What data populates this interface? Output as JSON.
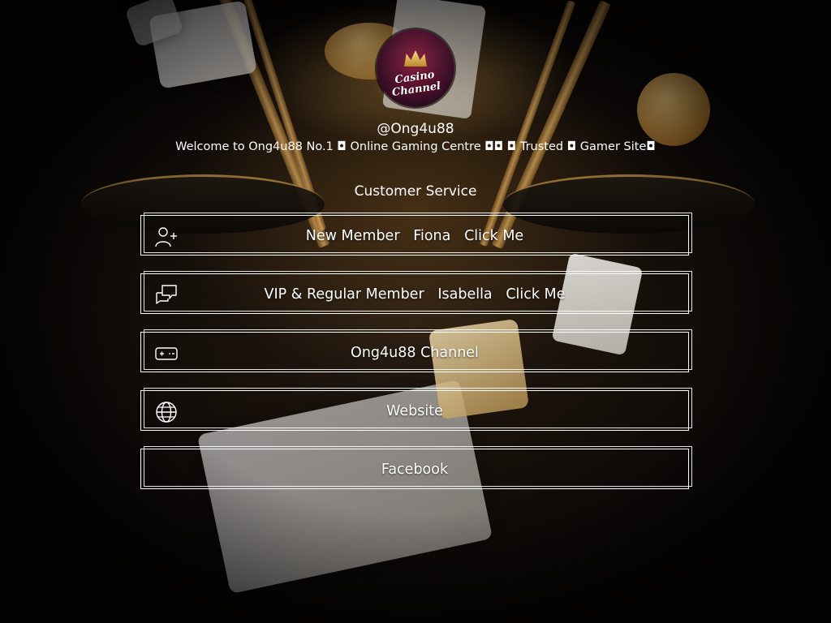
{
  "profile": {
    "avatar_text": "Casino Channel",
    "handle": "@Ong4u88",
    "welcome": "Welcome to Ong4u88 No.1 ◘ Online Gaming Centre ◘◘ ◘ Trusted ◘ Gamer Site◘"
  },
  "section": {
    "title": "Customer Service"
  },
  "links": [
    {
      "label": "New Member   Fiona   Click Me",
      "icon": "add-user-icon"
    },
    {
      "label": "VIP & Regular Member   Isabella   Click Me",
      "icon": "chat-bubbles-icon"
    },
    {
      "label": "Ong4u88 Channel",
      "icon": "gamepad-icon"
    },
    {
      "label": "Website",
      "icon": "globe-icon"
    },
    {
      "label": "Facebook",
      "icon": ""
    }
  ],
  "colors": {
    "text": "#ffffff",
    "border": "#ffffff",
    "background": "#0b0908",
    "accent_gold": "#d9a24a"
  }
}
